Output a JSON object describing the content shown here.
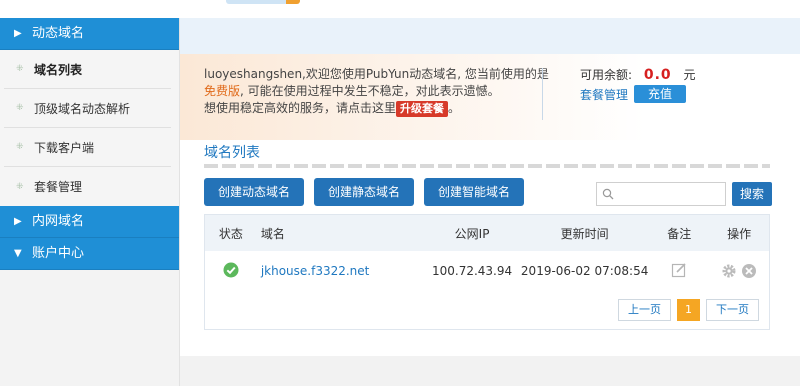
{
  "sidebar": {
    "sections": [
      {
        "label": "动态域名",
        "icon": "triangle-right-icon"
      },
      {
        "label": "内网域名",
        "icon": "triangle-right-icon"
      },
      {
        "label": "账户中心",
        "icon": "triangle-down-icon"
      }
    ],
    "items": [
      {
        "label": "域名列表",
        "active": true
      },
      {
        "label": "顶级域名动态解析"
      },
      {
        "label": "下载客户端"
      },
      {
        "label": "套餐管理"
      }
    ]
  },
  "notice": {
    "line1": "luoyeshangshen,欢迎您使用PubYun动态域名, 您当前使用的是",
    "free_label": "免费版",
    "line2": ", 可能在使用过程中发生不稳定，对此表示遗憾。",
    "line3": "想使用稳定高效的服务，请点击这里",
    "upgrade_label": "升级套餐",
    "line3_end": "。"
  },
  "balance": {
    "label": "可用余额:",
    "amount": "0.0",
    "unit": "元",
    "package_link": "套餐管理",
    "recharge_label": "充值"
  },
  "list": {
    "title": "域名列表",
    "buttons": [
      "创建动态域名",
      "创建静态域名",
      "创建智能域名"
    ],
    "search_placeholder": "",
    "search_label": "搜索",
    "columns": [
      "状态",
      "域名",
      "公网IP",
      "更新时间",
      "备注",
      "操作"
    ],
    "rows": [
      {
        "status": "ok",
        "domain": "jkhouse.f3322.net",
        "ip": "100.72.43.94",
        "updated": "2019-06-02 07:08:54"
      }
    ],
    "pager": {
      "prev": "上一页",
      "current": "1",
      "next": "下一页"
    }
  },
  "colors": {
    "primary": "#1f8fd6",
    "button": "#2473b8",
    "accent_orange": "#f5a623",
    "danger": "#d73a2a",
    "status_ok": "#5cb85c"
  }
}
